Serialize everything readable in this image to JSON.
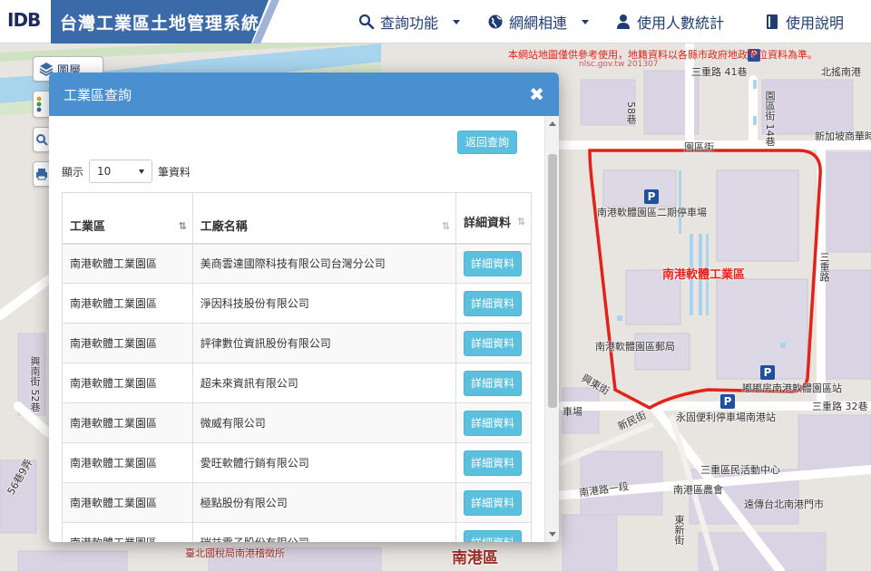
{
  "header": {
    "logo_text": "IDB",
    "title": "台灣工業區土地管理系統",
    "nav": [
      {
        "label": "查詢功能",
        "icon": "search-icon",
        "dropdown": true
      },
      {
        "label": "網網相連",
        "icon": "globe-icon",
        "dropdown": true
      },
      {
        "label": "使用人數統計",
        "icon": "user-icon",
        "dropdown": false
      },
      {
        "label": "使用說明",
        "icon": "book-icon",
        "dropdown": false
      }
    ]
  },
  "disclaimer": "本網站地圖僅供參考使用，地籍資料以各縣市政府地政單位資料為準。",
  "map_ref_label": "nlsc.gov.tw 201307",
  "tools": {
    "layers_label": "圖層"
  },
  "map": {
    "area_label": "南港軟體工業區",
    "district_label": "南港區",
    "labels": [
      "三重路 41巷",
      "園區街 14巷",
      "園區街",
      "北搖南港",
      "新加坡商華時",
      "58巷",
      "南港軟體園區二期停車場",
      "南港軟體園區郵局",
      "嘟嘟房南港軟體園區站",
      "永固便利停車場南港站",
      "三重路 32巷",
      "興東街",
      "新民街",
      "三重路",
      "三重區民活動中心",
      "南港路一段",
      "南港區農會",
      "遠傳台北南港門市",
      "東新街",
      "興南街 52巷",
      "56巷9弄",
      "車場",
      "臺北國稅局南港稽徵所"
    ],
    "colors": {
      "area_outline": "#e2231a",
      "river": "#a8d4ee",
      "road": "#ffffff"
    }
  },
  "modal": {
    "title": "工業區查詢",
    "back_label": "返回查詢",
    "length_prefix": "顯示",
    "length_value": "10",
    "length_suffix": "筆資料",
    "columns": [
      "工業區",
      "工廠名稱",
      "詳細資料"
    ],
    "detail_label": "詳細資料",
    "rows": [
      {
        "area": "南港軟體工業園區",
        "factory": "美商雲達國際科技有限公司台灣分公司"
      },
      {
        "area": "南港軟體工業園區",
        "factory": "淨因科技股份有限公司"
      },
      {
        "area": "南港軟體工業園區",
        "factory": "評律數位資訊股份有限公司"
      },
      {
        "area": "南港軟體工業園區",
        "factory": "超未來資訊有限公司"
      },
      {
        "area": "南港軟體工業園區",
        "factory": "微威有限公司"
      },
      {
        "area": "南港軟體工業園區",
        "factory": "愛旺軟體行銷有限公司"
      },
      {
        "area": "南港軟體工業園區",
        "factory": "極點股份有限公司"
      },
      {
        "area": "南港軟體工業園區",
        "factory": "瑞益電子股份有限公司"
      }
    ]
  }
}
